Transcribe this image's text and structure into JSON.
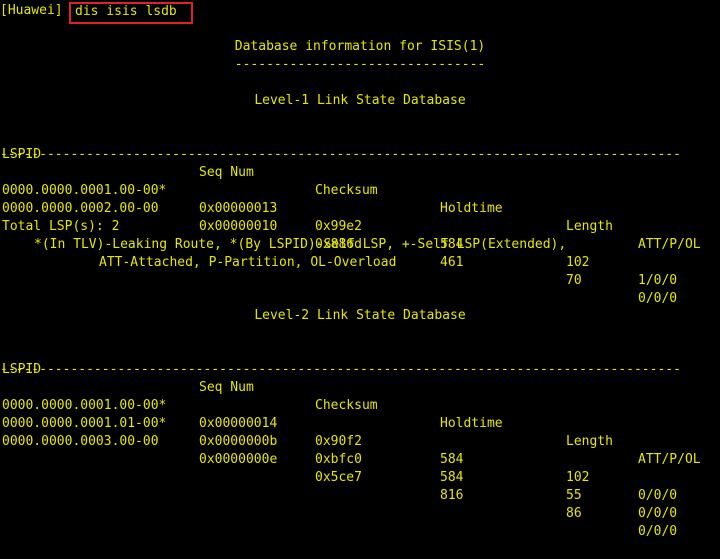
{
  "prompt": "[Huawei]",
  "command": "dis isis lsdb",
  "db_title": "Database information for ISIS(1)",
  "db_title_underline": "--------------------------------",
  "columns": [
    "LSPID",
    "Seq Num",
    "Checksum",
    "Holdtime",
    "Length",
    "ATT/P/OL"
  ],
  "separator": "---------------------------------------------------------------------------------------",
  "level1": {
    "title": "Level-1 Link State Database",
    "rows": [
      [
        "0000.0000.0001.00-00*",
        "0x00000013",
        "0x99e2",
        "584",
        "102",
        "1/0/0"
      ],
      [
        "0000.0000.0002.00-00",
        "0x00000010",
        "0x886d",
        "461",
        "70",
        "0/0/0"
      ]
    ],
    "total": "Total LSP(s): 2",
    "legend1": "*(In TLV)-Leaking Route, *(By LSPID)-Self LSP, +-Self LSP(Extended),",
    "legend2": "ATT-Attached, P-Partition, OL-Overload"
  },
  "level2": {
    "title": "Level-2 Link State Database",
    "rows": [
      [
        "0000.0000.0001.00-00*",
        "0x00000014",
        "0x90f2",
        "584",
        "102",
        "0/0/0"
      ],
      [
        "0000.0000.0001.01-00*",
        "0x0000000b",
        "0xbfc0",
        "584",
        "55",
        "0/0/0"
      ],
      [
        "0000.0000.0003.00-00",
        "0x0000000e",
        "0x5ce7",
        "816",
        "86",
        "0/0/0"
      ]
    ]
  },
  "colors": {
    "text": "#e6e600",
    "background": "#000000",
    "highlight": "#e0202a"
  }
}
